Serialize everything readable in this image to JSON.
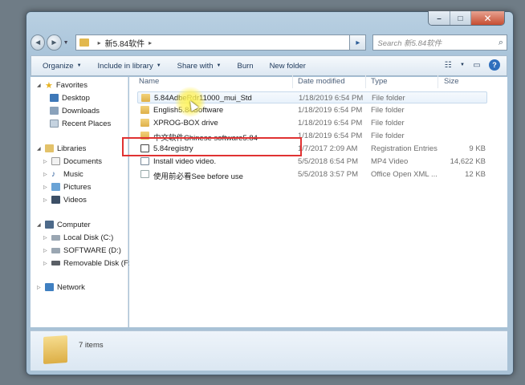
{
  "window": {
    "controls": {
      "minimize": "–",
      "maximize": "□",
      "close": "✕"
    }
  },
  "address": {
    "back_icon": "◄",
    "forward_icon": "►",
    "path": "新5.84软件",
    "separator": "▸",
    "refresh_icon": "▸"
  },
  "search": {
    "placeholder": "Search 新5.84软件",
    "icon": "⌕"
  },
  "toolbar": {
    "organize": "Organize",
    "include_in_library": "Include in library",
    "share_with": "Share with",
    "burn": "Burn",
    "new_folder": "New folder",
    "caret": "▼",
    "view_icon": "☷",
    "preview_icon": "▭",
    "help_icon": "?"
  },
  "nav": {
    "favorites": "Favorites",
    "desktop": "Desktop",
    "downloads": "Downloads",
    "recent_places": "Recent Places",
    "libraries": "Libraries",
    "documents": "Documents",
    "music": "Music",
    "pictures": "Pictures",
    "videos": "Videos",
    "computer": "Computer",
    "local_disk": "Local Disk (C:)",
    "software": "SOFTWARE (D:)",
    "removable": "Removable Disk (F:)",
    "network": "Network",
    "collapse_glyph": "◢",
    "expand_glyph": "▷"
  },
  "columns": {
    "name": "Name",
    "date_modified": "Date modified",
    "type": "Type",
    "size": "Size"
  },
  "files": [
    {
      "name": "5.84AdbeRdr11000_mui_Std",
      "date": "1/18/2019 6:54 PM",
      "type": "File folder",
      "size": ""
    },
    {
      "name": "English5.84Software",
      "date": "1/18/2019 6:54 PM",
      "type": "File folder",
      "size": ""
    },
    {
      "name": "XPROG-BOX drive",
      "date": "1/18/2019 6:54 PM",
      "type": "File folder",
      "size": ""
    },
    {
      "name": "中文软件Chinese software5.84",
      "date": "1/18/2019 6:54 PM",
      "type": "File folder",
      "size": ""
    },
    {
      "name": "5.84registry",
      "date": "1/7/2017 2:09 AM",
      "type": "Registration Entries",
      "size": "9 KB"
    },
    {
      "name": "Install video video.",
      "date": "5/5/2018 6:54 PM",
      "type": "MP4 Video",
      "size": "14,622 KB"
    },
    {
      "name": "使用前必看See before use",
      "date": "5/5/2018 3:57 PM",
      "type": "Office Open XML ...",
      "size": "12 KB"
    }
  ],
  "status": {
    "items_count": "7 items"
  },
  "colors": {
    "highlight_box": "#e03232",
    "cursor_glow": "#fff55a"
  }
}
